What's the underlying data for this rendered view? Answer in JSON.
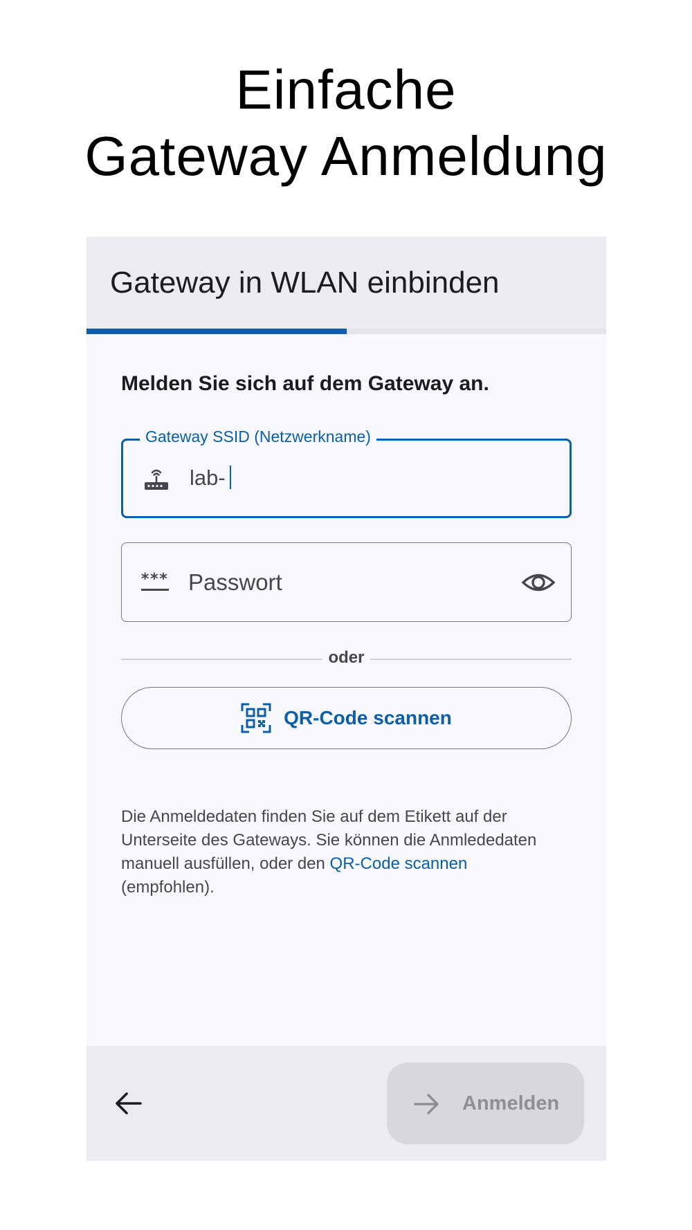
{
  "headline": {
    "line1": "Einfache",
    "line2": "Gateway Anmeldung"
  },
  "appbar": {
    "title": "Gateway in WLAN einbinden",
    "progress": 0.5
  },
  "form": {
    "heading": "Melden Sie sich auf dem Gateway an.",
    "ssid": {
      "label": "Gateway SSID (Netzwerkname)",
      "value": "lab-",
      "icon": "router-icon"
    },
    "password": {
      "placeholder": "Passwort",
      "icon": "password-icon",
      "toggle_icon": "eye-icon"
    },
    "divider_text": "oder",
    "qr_button": {
      "label": "QR-Code scannen",
      "icon": "qr-code-scan-icon"
    },
    "info": {
      "text_before": "Die Anmeldedaten finden Sie auf dem Etikett auf der Unterseite des Gateways. Sie können die Anmlededaten manuell ausfüllen, oder den",
      "link": "QR-Code scannen",
      "text_after": "(empfohlen)."
    }
  },
  "footer": {
    "back_icon": "arrow-left-icon",
    "submit_label": "Anmelden",
    "submit_icon": "arrow-right-icon"
  },
  "colors": {
    "accent": "#0d5ea6",
    "surface": "#f7f8fb",
    "bar": "#ececf0",
    "disabled_button": "#d8d8dc"
  }
}
